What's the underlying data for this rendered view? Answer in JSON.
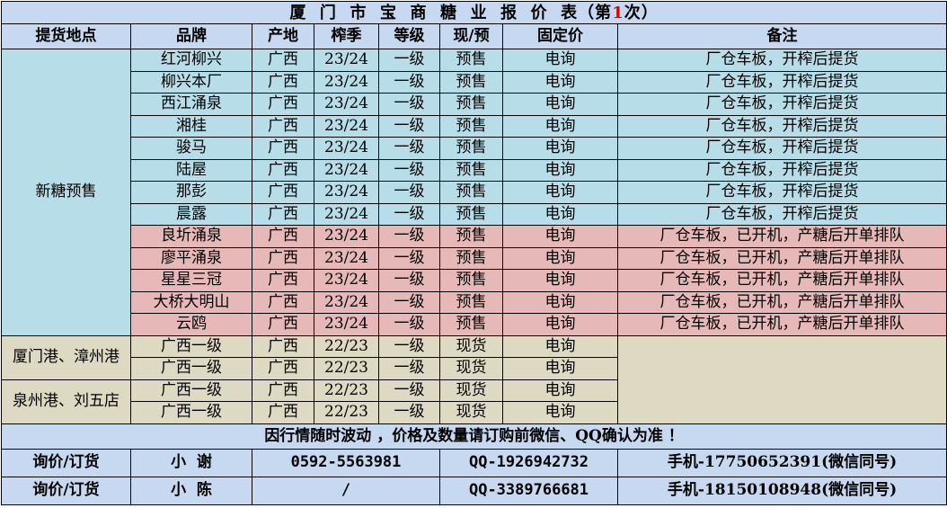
{
  "title": {
    "main": "厦  门  市  宝  商  糖  业  报  价  表（第",
    "number": "1",
    "suffix": "次）"
  },
  "headers": [
    "提货地点",
    "品牌",
    "产地",
    "榨季",
    "等级",
    "现/预",
    "固定价",
    "备注"
  ],
  "groups": {
    "presale": "新糖预售",
    "xiamen": "厦门港、漳州港",
    "quanzhou": "泉州港、刘五店"
  },
  "rows": [
    {
      "brand": "红河柳兴",
      "origin": "广西",
      "season": "23/24",
      "grade": "一级",
      "type": "预售",
      "price": "电询",
      "note": "厂仓车板，开榨后提货"
    },
    {
      "brand": "柳兴本厂",
      "origin": "广西",
      "season": "23/24",
      "grade": "一级",
      "type": "预售",
      "price": "电询",
      "note": "厂仓车板，开榨后提货"
    },
    {
      "brand": "西江涌泉",
      "origin": "广西",
      "season": "23/24",
      "grade": "一级",
      "type": "预售",
      "price": "电询",
      "note": "厂仓车板，开榨后提货"
    },
    {
      "brand": "湘桂",
      "origin": "广西",
      "season": "23/24",
      "grade": "一级",
      "type": "预售",
      "price": "电询",
      "note": "厂仓车板，开榨后提货"
    },
    {
      "brand": "骏马",
      "origin": "广西",
      "season": "23/24",
      "grade": "一级",
      "type": "预售",
      "price": "电询",
      "note": "厂仓车板，开榨后提货"
    },
    {
      "brand": "陆屋",
      "origin": "广西",
      "season": "23/24",
      "grade": "一级",
      "type": "预售",
      "price": "电询",
      "note": "厂仓车板，开榨后提货"
    },
    {
      "brand": "那彭",
      "origin": "广西",
      "season": "23/24",
      "grade": "一级",
      "type": "预售",
      "price": "电询",
      "note": "厂仓车板，开榨后提货"
    },
    {
      "brand": "晨露",
      "origin": "广西",
      "season": "23/24",
      "grade": "一级",
      "type": "预售",
      "price": "电询",
      "note": "厂仓车板，开榨后提货"
    },
    {
      "brand": "良圻涌泉",
      "origin": "广西",
      "season": "23/24",
      "grade": "一级",
      "type": "预售",
      "price": "电询",
      "note": "厂仓车板，已开机，产糖后开单排队"
    },
    {
      "brand": "廖平涌泉",
      "origin": "广西",
      "season": "23/24",
      "grade": "一级",
      "type": "预售",
      "price": "电询",
      "note": "厂仓车板，已开机，产糖后开单排队"
    },
    {
      "brand": "星星三冠",
      "origin": "广西",
      "season": "23/24",
      "grade": "一级",
      "type": "预售",
      "price": "电询",
      "note": "厂仓车板，已开机，产糖后开单排队"
    },
    {
      "brand": "大桥大明山",
      "origin": "广西",
      "season": "23/24",
      "grade": "一级",
      "type": "预售",
      "price": "电询",
      "note": "厂仓车板，已开机，产糖后开单排队"
    },
    {
      "brand": "云鸥",
      "origin": "广西",
      "season": "23/24",
      "grade": "一级",
      "type": "预售",
      "price": "电询",
      "note": "厂仓车板，已开机，产糖后开单排队"
    },
    {
      "brand": "广西一级",
      "origin": "广西",
      "season": "22/23",
      "grade": "一级",
      "type": "现货",
      "price": "电询",
      "note": ""
    },
    {
      "brand": "广西一级",
      "origin": "广西",
      "season": "22/23",
      "grade": "一级",
      "type": "现货",
      "price": "电询",
      "note": ""
    },
    {
      "brand": "广西一级",
      "origin": "广西",
      "season": "22/23",
      "grade": "一级",
      "type": "现货",
      "price": "电询",
      "note": ""
    },
    {
      "brand": "广西一级",
      "origin": "广西",
      "season": "22/23",
      "grade": "一级",
      "type": "现货",
      "price": "电询",
      "note": ""
    }
  ],
  "notice": "因行情随时波动 ，价格及数量请订购前微信、QQ确认为准 ！",
  "contacts": [
    {
      "label": "询价/订货",
      "name": "小  谢",
      "phone": "0592-5563981",
      "qq": "QQ-1926942732",
      "mobile": "手机-17750652391(微信同号)"
    },
    {
      "label": "询价/订货",
      "name": "小  陈",
      "phone": "/",
      "qq": "QQ-3389766681",
      "mobile": "手机-18150108948(微信同号)"
    }
  ],
  "colors": {
    "header_bg": "#c6d9f0",
    "presale_bg": "#b7dde8",
    "queue_bg": "#e6b9b8",
    "spot_bg": "#ddd9c3",
    "title_accent": "#e00000"
  }
}
